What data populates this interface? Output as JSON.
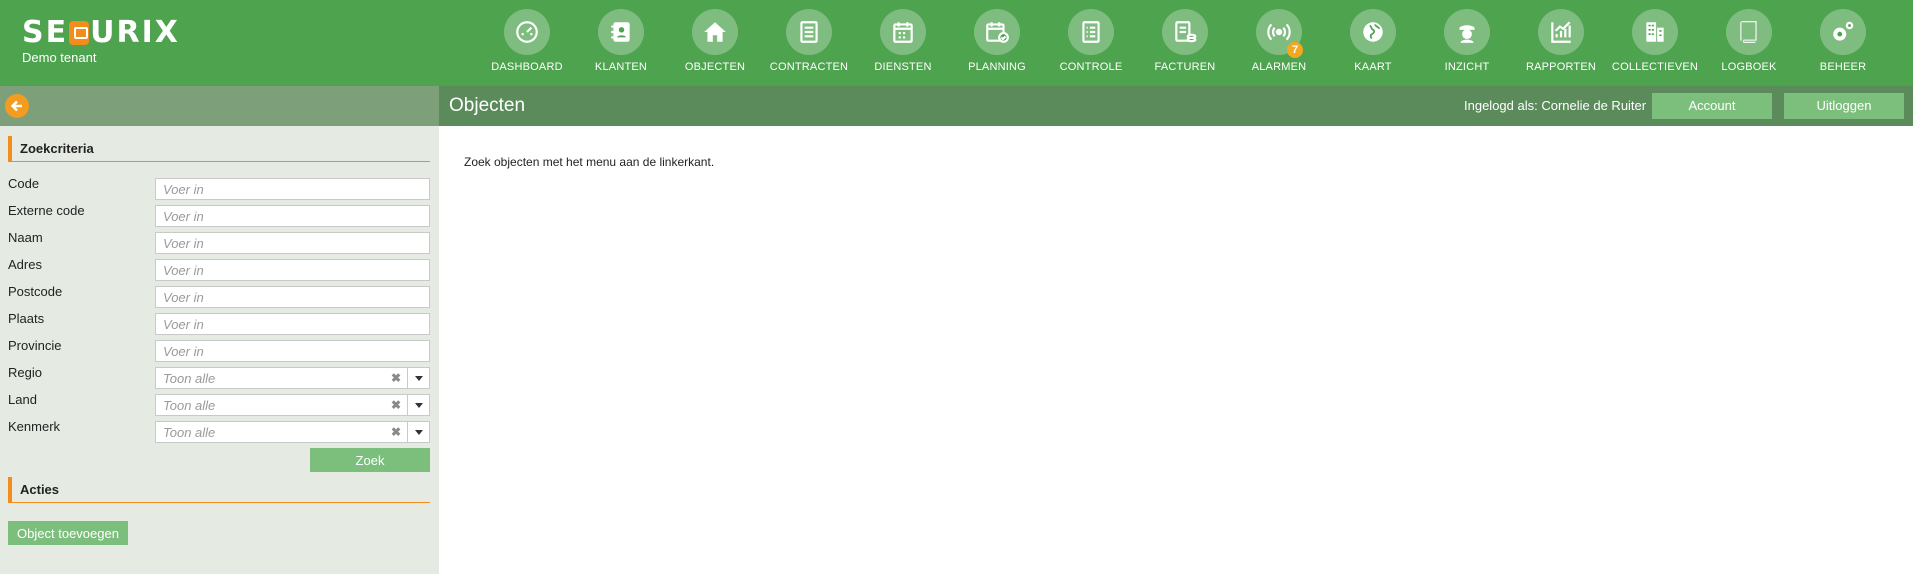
{
  "brand": {
    "logo_text_left": "SE",
    "logo_text_right": "URIX",
    "tenant": "Demo tenant"
  },
  "nav": {
    "items": [
      {
        "label": "DASHBOARD",
        "icon": "gauge-icon"
      },
      {
        "label": "KLANTEN",
        "icon": "contact-book-icon"
      },
      {
        "label": "OBJECTEN",
        "icon": "home-icon"
      },
      {
        "label": "CONTRACTEN",
        "icon": "document-icon"
      },
      {
        "label": "DIENSTEN",
        "icon": "calendar-icon"
      },
      {
        "label": "PLANNING",
        "icon": "calendar-check-icon"
      },
      {
        "label": "CONTROLE",
        "icon": "checklist-icon"
      },
      {
        "label": "FACTUREN",
        "icon": "invoice-coins-icon"
      },
      {
        "label": "ALARMEN",
        "icon": "broadcast-icon",
        "badge": "7"
      },
      {
        "label": "KAART",
        "icon": "globe-icon"
      },
      {
        "label": "INZICHT",
        "icon": "guard-icon"
      },
      {
        "label": "RAPPORTEN",
        "icon": "chart-icon"
      },
      {
        "label": "COLLECTIEVEN",
        "icon": "buildings-icon"
      },
      {
        "label": "LOGBOEK",
        "icon": "book-icon"
      },
      {
        "label": "BEHEER",
        "icon": "gears-icon"
      }
    ]
  },
  "sidebar": {
    "back_icon": "arrow-left-icon",
    "search_title": "Zoekcriteria",
    "fields": [
      {
        "label": "Code",
        "placeholder": "Voer in"
      },
      {
        "label": "Externe code",
        "placeholder": "Voer in"
      },
      {
        "label": "Naam",
        "placeholder": "Voer in"
      },
      {
        "label": "Adres",
        "placeholder": "Voer in"
      },
      {
        "label": "Postcode",
        "placeholder": "Voer in"
      },
      {
        "label": "Plaats",
        "placeholder": "Voer in"
      },
      {
        "label": "Provincie",
        "placeholder": "Voer in"
      }
    ],
    "selects": [
      {
        "label": "Regio",
        "placeholder": "Toon alle"
      },
      {
        "label": "Land",
        "placeholder": "Toon alle"
      },
      {
        "label": "Kenmerk",
        "placeholder": "Toon alle"
      }
    ],
    "clear_glyph": "✖",
    "search_button": "Zoek",
    "actions_title": "Acties",
    "add_button": "Object toevoegen"
  },
  "header": {
    "title": "Objecten",
    "logged_in": "Ingelogd als: Cornelie de Ruiter",
    "account_button": "Account",
    "logout_button": "Uitloggen"
  },
  "main": {
    "message": "Zoek objecten met het menu aan de linkerkant."
  },
  "colors": {
    "topbar": "#4ea34f",
    "accent": "#f28c1a",
    "button": "#7cbf7c",
    "header": "#5b8a5b",
    "sidebar": "#e5ebe2"
  }
}
